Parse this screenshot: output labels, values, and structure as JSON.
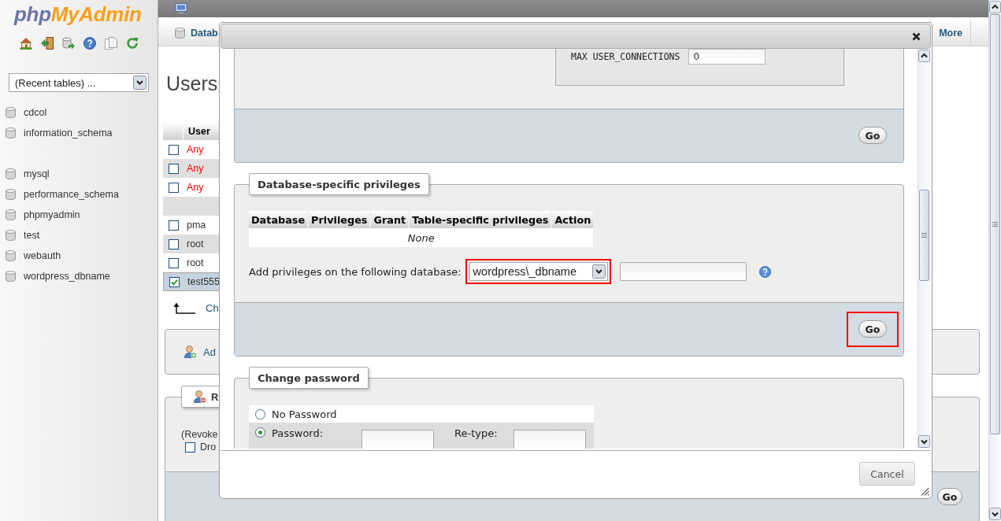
{
  "sidebar": {
    "logo": {
      "first": "php",
      "second": "MyAdmin"
    },
    "recent_tables": {
      "value": "(Recent tables) ..."
    },
    "database_groups": [
      {
        "items": [
          {
            "name": "cdcol"
          },
          {
            "name": "information_schema"
          }
        ]
      },
      {
        "items": [
          {
            "name": "mysql"
          },
          {
            "name": "performance_schema"
          },
          {
            "name": "phpmyadmin"
          },
          {
            "name": "test"
          },
          {
            "name": "webauth"
          },
          {
            "name": "wordpress_dbname"
          }
        ]
      }
    ]
  },
  "main": {
    "tabs": [
      {
        "label": "Datab",
        "selected": false
      },
      {
        "label": "More",
        "selected": false
      }
    ],
    "heading": "Users",
    "users_table": {
      "columns": [
        "User"
      ],
      "rows": [
        {
          "kind": "anonymous",
          "user": "Any",
          "checked": false,
          "selected": false
        },
        {
          "kind": "anonymous",
          "user": "Any",
          "checked": false,
          "selected": false
        },
        {
          "kind": "anonymous",
          "user": "Any",
          "checked": false,
          "selected": false
        },
        {
          "kind": "blank",
          "selected": false
        },
        {
          "kind": "user",
          "user": "pma",
          "checked": false,
          "selected": false
        },
        {
          "kind": "user",
          "user": "root",
          "checked": false,
          "selected": false
        },
        {
          "kind": "user",
          "user": "root",
          "checked": false,
          "selected": false
        },
        {
          "kind": "user",
          "user": "test555",
          "checked": true,
          "selected": true
        }
      ]
    },
    "check_all_link": "Ch",
    "add_user_link": "Ad",
    "revoke": {
      "legend": "R",
      "note": "(Revoke",
      "drop_checkbox": {
        "label": "Dro",
        "checked": false
      },
      "go": "Go"
    }
  },
  "dialog": {
    "resource_limits": {
      "label": "MAX USER_CONNECTIONS",
      "value": "0",
      "go": {
        "label": "Go",
        "highlighted": false
      }
    },
    "db_privileges": {
      "legend": "Database-specific privileges",
      "columns": [
        "Database",
        "Privileges",
        "Grant",
        "Table-specific privileges",
        "Action"
      ],
      "empty_text": "None",
      "add_label": "Add privileges on the following database:",
      "database_select": {
        "value": "wordpress\\_dbname",
        "highlighted": true
      },
      "go": {
        "label": "Go",
        "highlighted": true
      }
    },
    "change_password": {
      "legend": "Change password",
      "options": [
        {
          "kind": "none",
          "label": "No Password",
          "selected": false
        },
        {
          "kind": "password",
          "label": "Password:",
          "selected": true,
          "retype_label": "Re-type:"
        }
      ]
    },
    "cancel": "Cancel"
  }
}
